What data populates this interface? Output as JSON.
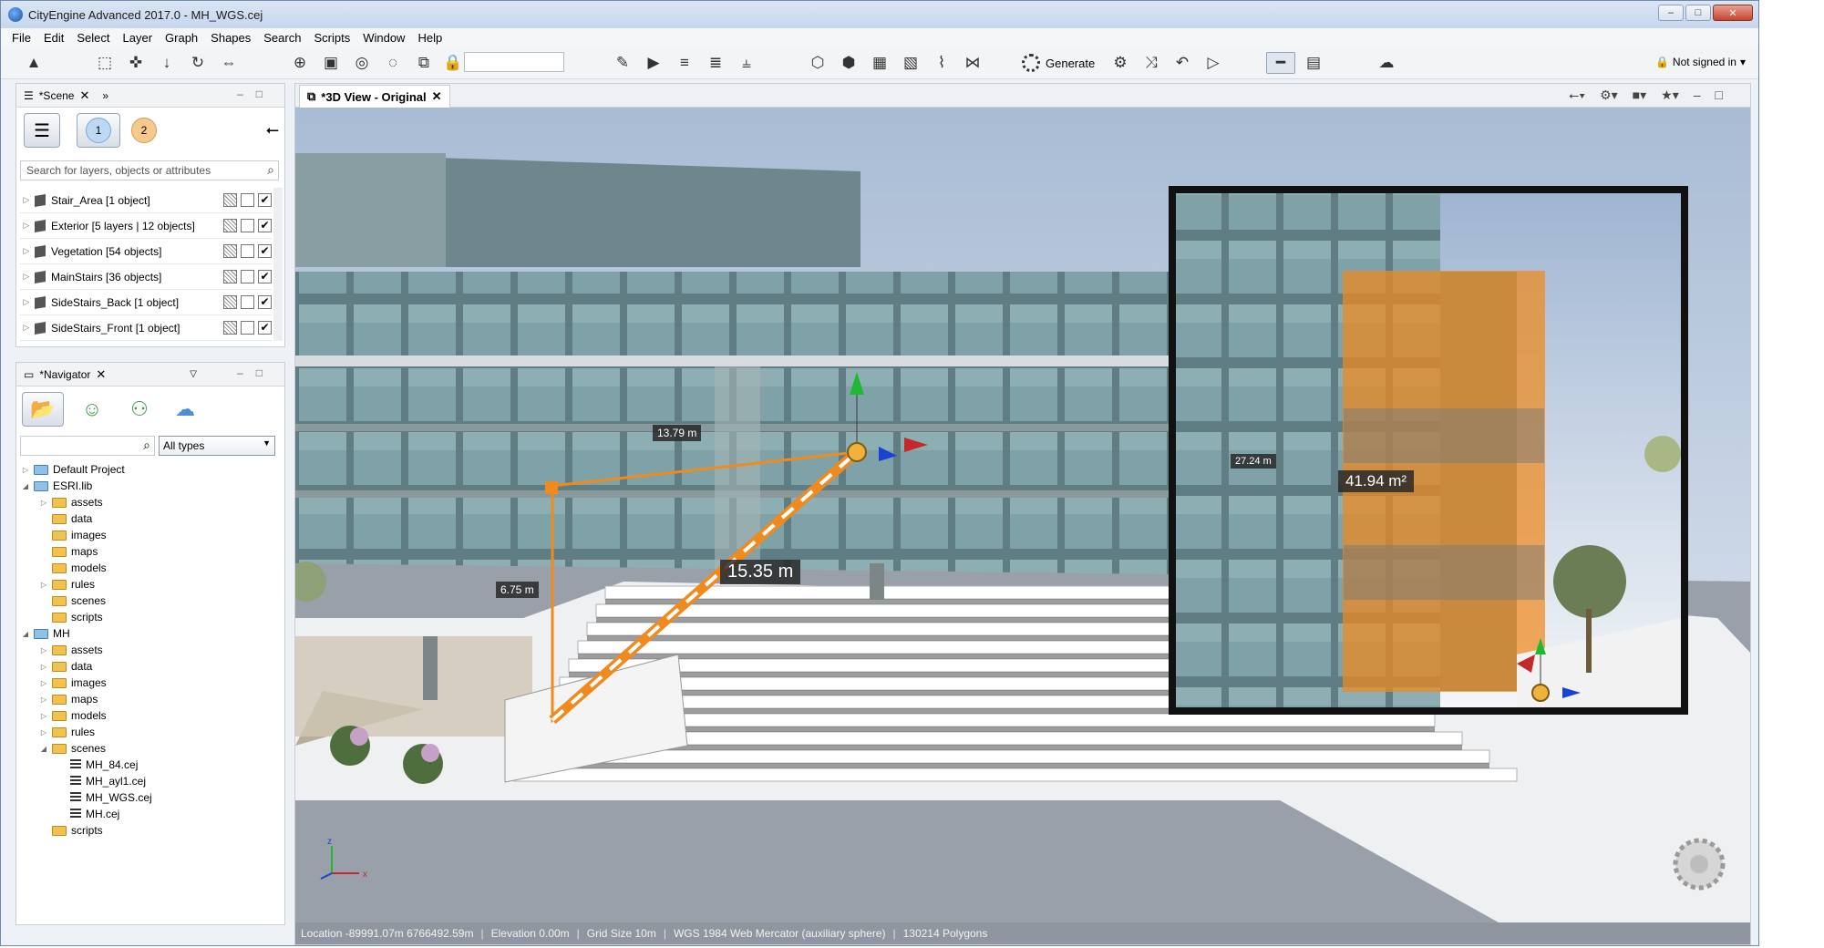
{
  "window": {
    "title": "CityEngine Advanced 2017.0 - MH_WGS.cej",
    "min": "–",
    "max": "□",
    "close": "✕"
  },
  "menu": [
    "File",
    "Edit",
    "Select",
    "Layer",
    "Graph",
    "Shapes",
    "Search",
    "Scripts",
    "Window",
    "Help"
  ],
  "toolbar": {
    "generate_label": "Generate",
    "signin": "Not signed in"
  },
  "scene_panel": {
    "tab_label": "*Scene",
    "search_placeholder": "Search for layers, objects or attributes",
    "badge1": "1",
    "badge2": "2",
    "layers": [
      {
        "label": "Stair_Area [1 object]",
        "visible": true
      },
      {
        "label": "Exterior [5 layers | 12 objects]",
        "visible": true
      },
      {
        "label": "Vegetation [54 objects]",
        "visible": true
      },
      {
        "label": "MainStairs [36 objects]",
        "visible": true
      },
      {
        "label": "SideStairs_Back [1 object]",
        "visible": true
      },
      {
        "label": "SideStairs_Front [1 object]",
        "visible": true
      }
    ]
  },
  "navigator_panel": {
    "tab_label": "*Navigator",
    "type_filter": "All types",
    "tree": [
      {
        "label": "Default Project",
        "depth": 0,
        "kind": "project",
        "toggle": "▷"
      },
      {
        "label": "ESRI.lib",
        "depth": 0,
        "kind": "project",
        "toggle": "◢"
      },
      {
        "label": "assets",
        "depth": 1,
        "kind": "folder",
        "toggle": "▷"
      },
      {
        "label": "data",
        "depth": 1,
        "kind": "folder",
        "toggle": ""
      },
      {
        "label": "images",
        "depth": 1,
        "kind": "folder",
        "toggle": ""
      },
      {
        "label": "maps",
        "depth": 1,
        "kind": "folder",
        "toggle": ""
      },
      {
        "label": "models",
        "depth": 1,
        "kind": "folder",
        "toggle": ""
      },
      {
        "label": "rules",
        "depth": 1,
        "kind": "folder",
        "toggle": "▷"
      },
      {
        "label": "scenes",
        "depth": 1,
        "kind": "folder",
        "toggle": ""
      },
      {
        "label": "scripts",
        "depth": 1,
        "kind": "folder",
        "toggle": ""
      },
      {
        "label": "MH",
        "depth": 0,
        "kind": "project",
        "toggle": "◢"
      },
      {
        "label": "assets",
        "depth": 1,
        "kind": "folder",
        "toggle": "▷"
      },
      {
        "label": "data",
        "depth": 1,
        "kind": "folder",
        "toggle": "▷"
      },
      {
        "label": "images",
        "depth": 1,
        "kind": "folder",
        "toggle": "▷"
      },
      {
        "label": "maps",
        "depth": 1,
        "kind": "folder",
        "toggle": "▷"
      },
      {
        "label": "models",
        "depth": 1,
        "kind": "folder",
        "toggle": "▷"
      },
      {
        "label": "rules",
        "depth": 1,
        "kind": "folder",
        "toggle": "▷"
      },
      {
        "label": "scenes",
        "depth": 1,
        "kind": "folder",
        "toggle": "◢"
      },
      {
        "label": "MH_84.cej",
        "depth": 2,
        "kind": "scene",
        "toggle": ""
      },
      {
        "label": "MH_ayl1.cej",
        "depth": 2,
        "kind": "scene",
        "toggle": ""
      },
      {
        "label": "MH_WGS.cej",
        "depth": 2,
        "kind": "scene",
        "toggle": ""
      },
      {
        "label": "MH.cej",
        "depth": 2,
        "kind": "scene",
        "toggle": ""
      },
      {
        "label": "scripts",
        "depth": 1,
        "kind": "folder",
        "toggle": ""
      }
    ]
  },
  "view": {
    "tab_label": "*3D View - Original",
    "measurements": {
      "height_label": "13.79 m",
      "side_label": "6.75 m",
      "diagonal_label": "15.35 m",
      "inset_side_label": "27.24 m",
      "inset_area_label": "41.94 m²"
    },
    "axis_labels": {
      "z": "z",
      "x": "x"
    },
    "colors": {
      "measure": "#f08a1e",
      "sky": "#c7d6ea",
      "facade": "#7b9aa0",
      "ground": "#f2f2f2"
    }
  },
  "status": {
    "location": "Location  -89991.07m 6766492.59m",
    "elevation": "Elevation 0.00m",
    "grid": "Grid Size 10m",
    "crs": "WGS 1984 Web Mercator (auxiliary sphere)",
    "polygons": "130214 Polygons"
  }
}
